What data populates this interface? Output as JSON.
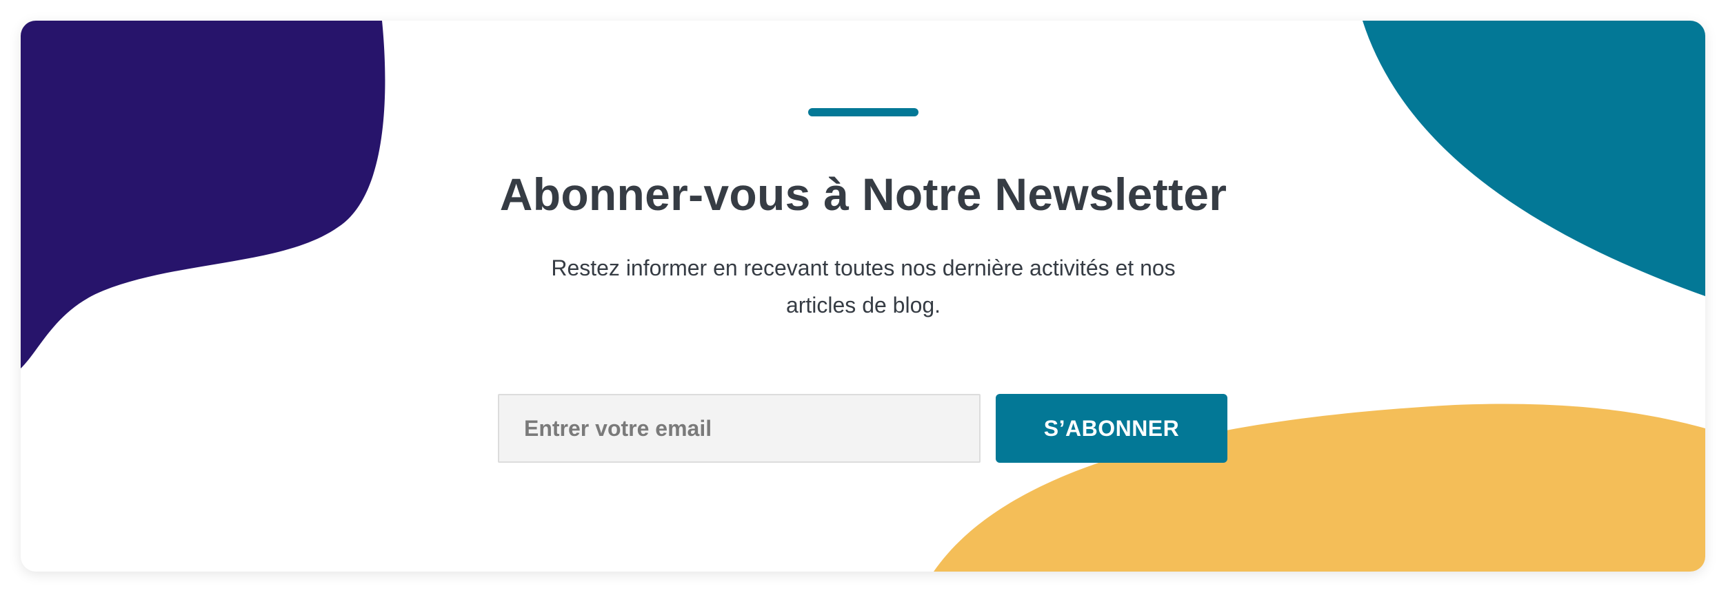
{
  "newsletter": {
    "title": "Abonner-vous à Notre Newsletter",
    "subtitle": "Restez informer en recevant toutes nos dernière activités et nos articles de blog.",
    "email_placeholder": "Entrer votre email",
    "subscribe_label": "S’ABONNER"
  },
  "colors": {
    "accent": "#037896",
    "navy_blob": "#27146b",
    "teal_blob": "#037896",
    "yellow_blob": "#f4be58",
    "title_text": "#363c44"
  }
}
